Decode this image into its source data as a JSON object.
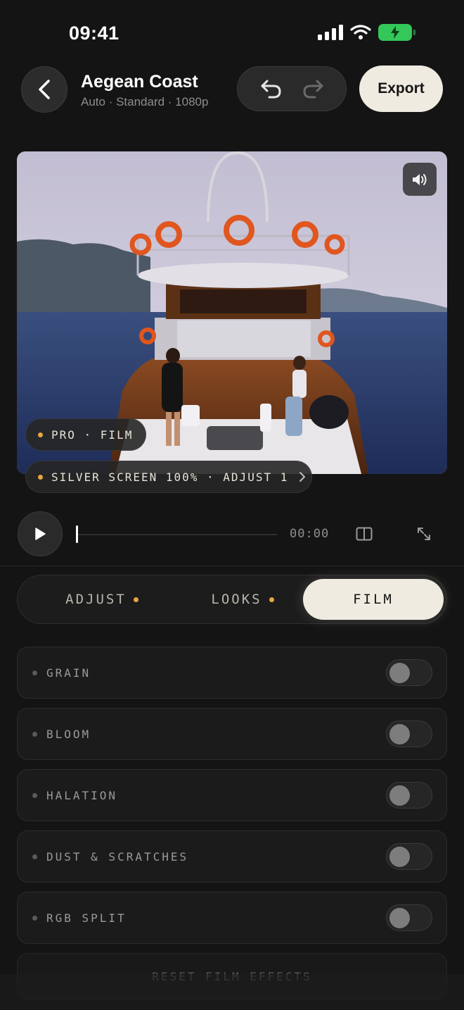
{
  "status_bar": {
    "time": "09:41",
    "signal_icon": "cellular-signal-icon",
    "wifi_icon": "wifi-icon",
    "battery_icon": "battery-charging-icon",
    "battery_color": "#34c759"
  },
  "header": {
    "back_icon": "chevron-left-icon",
    "title": "Aegean Coast",
    "subtitle": "Auto · Standard · 1080p",
    "undo_icon": "undo-icon",
    "redo_icon": "redo-icon",
    "export_label": "Export"
  },
  "preview": {
    "mute_icon": "speaker-icon",
    "badge_mode": "PRO · FILM",
    "badge_look": "SILVER SCREEN 100% · ADJUST 1",
    "badge_look_chevron": "chevron-right-icon"
  },
  "playback": {
    "play_icon": "play-icon",
    "progress": 0.0,
    "timecode": "00:00",
    "compare_icon": "split-compare-icon",
    "fullscreen_icon": "expand-icon"
  },
  "tabs": [
    {
      "label": "ADJUST",
      "has_dot": true,
      "active": false
    },
    {
      "label": "LOOKS",
      "has_dot": true,
      "active": false
    },
    {
      "label": "FILM",
      "has_dot": false,
      "active": true
    }
  ],
  "film_effects": [
    {
      "label": "GRAIN",
      "enabled": false
    },
    {
      "label": "BLOOM",
      "enabled": false
    },
    {
      "label": "HALATION",
      "enabled": false
    },
    {
      "label": "DUST & SCRATCHES",
      "enabled": false
    },
    {
      "label": "RGB SPLIT",
      "enabled": false
    }
  ],
  "reset_label": "RESET FILM EFFECTS",
  "colors": {
    "accent_dot": "#e8a640",
    "active_tab": "#efebe0",
    "background": "#141414"
  }
}
